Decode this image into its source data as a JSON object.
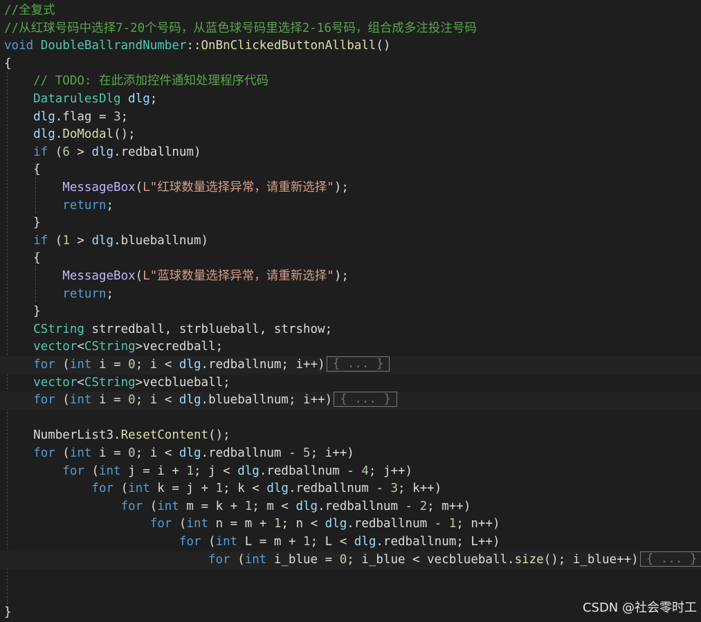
{
  "editor": {
    "lines": [
      [
        {
          "t": "//全复式",
          "c": "comment"
        }
      ],
      [
        {
          "t": "//从红球号码中选择7-20个号码，从蓝色球号码里选择2-16号码，组合成多注投注号码",
          "c": "comment"
        }
      ],
      [
        {
          "t": "void ",
          "c": "kw"
        },
        {
          "t": "DoubleBallrandNumber",
          "c": "type"
        },
        {
          "t": "::",
          "c": "plain"
        },
        {
          "t": "OnBnClickedButtonAllball",
          "c": "fn"
        },
        {
          "t": "()",
          "c": "plain"
        }
      ],
      [
        {
          "t": "{",
          "c": "plain"
        }
      ],
      [
        {
          "t": "    // TODO: 在此添加控件通知处理程序代码",
          "c": "comment"
        }
      ],
      [
        {
          "t": "    DatarulesDlg ",
          "c": "type"
        },
        {
          "t": "dlg",
          "c": "var"
        },
        {
          "t": ";",
          "c": "plain"
        }
      ],
      [
        {
          "t": "    dlg",
          "c": "var"
        },
        {
          "t": ".flag = ",
          "c": "plain"
        },
        {
          "t": "3",
          "c": "num"
        },
        {
          "t": ";",
          "c": "plain"
        }
      ],
      [
        {
          "t": "    dlg",
          "c": "var"
        },
        {
          "t": ".",
          "c": "plain"
        },
        {
          "t": "DoModal",
          "c": "fn"
        },
        {
          "t": "();",
          "c": "plain"
        }
      ],
      [
        {
          "t": "    if ",
          "c": "kw"
        },
        {
          "t": "(",
          "c": "plain"
        },
        {
          "t": "6",
          "c": "num"
        },
        {
          "t": " > ",
          "c": "plain"
        },
        {
          "t": "dlg",
          "c": "var"
        },
        {
          "t": ".redballnum)",
          "c": "plain"
        }
      ],
      [
        {
          "t": "    {",
          "c": "plain"
        }
      ],
      [
        {
          "t": "        MessageBox",
          "c": "macro"
        },
        {
          "t": "(",
          "c": "plain"
        },
        {
          "t": "L\"红球数量选择异常，请重新选择\"",
          "c": "str"
        },
        {
          "t": ");",
          "c": "plain"
        }
      ],
      [
        {
          "t": "        return",
          "c": "kw"
        },
        {
          "t": ";",
          "c": "plain"
        }
      ],
      [
        {
          "t": "    }",
          "c": "plain"
        }
      ],
      [
        {
          "t": "    if ",
          "c": "kw"
        },
        {
          "t": "(",
          "c": "plain"
        },
        {
          "t": "1",
          "c": "num"
        },
        {
          "t": " > ",
          "c": "plain"
        },
        {
          "t": "dlg",
          "c": "var"
        },
        {
          "t": ".blueballnum)",
          "c": "plain"
        }
      ],
      [
        {
          "t": "    {",
          "c": "plain"
        }
      ],
      [
        {
          "t": "        MessageBox",
          "c": "macro"
        },
        {
          "t": "(",
          "c": "plain"
        },
        {
          "t": "L\"蓝球数量选择异常，请重新选择\"",
          "c": "str"
        },
        {
          "t": ");",
          "c": "plain"
        }
      ],
      [
        {
          "t": "        return",
          "c": "kw"
        },
        {
          "t": ";",
          "c": "plain"
        }
      ],
      [
        {
          "t": "    }",
          "c": "plain"
        }
      ],
      [
        {
          "t": "    CString ",
          "c": "type"
        },
        {
          "t": "strredball, strblueball, strshow;",
          "c": "plain"
        }
      ],
      [
        {
          "t": "    vector",
          "c": "type"
        },
        {
          "t": "<",
          "c": "plain"
        },
        {
          "t": "CString",
          "c": "type"
        },
        {
          "t": ">",
          "c": "plain"
        },
        {
          "t": "vecredball;",
          "c": "plain"
        }
      ],
      [
        {
          "t": "    for ",
          "c": "kw"
        },
        {
          "t": "(",
          "c": "plain"
        },
        {
          "t": "int ",
          "c": "kw"
        },
        {
          "t": "i = ",
          "c": "plain"
        },
        {
          "t": "0",
          "c": "num"
        },
        {
          "t": "; i < ",
          "c": "plain"
        },
        {
          "t": "dlg",
          "c": "var"
        },
        {
          "t": ".redballnum; i++)",
          "c": "plain"
        }
      ],
      [
        {
          "t": "    vector",
          "c": "type"
        },
        {
          "t": "<",
          "c": "plain"
        },
        {
          "t": "CString",
          "c": "type"
        },
        {
          "t": ">",
          "c": "plain"
        },
        {
          "t": "vecblueball;",
          "c": "plain"
        }
      ],
      [
        {
          "t": "    for ",
          "c": "kw"
        },
        {
          "t": "(",
          "c": "plain"
        },
        {
          "t": "int ",
          "c": "kw"
        },
        {
          "t": "i = ",
          "c": "plain"
        },
        {
          "t": "0",
          "c": "num"
        },
        {
          "t": "; i < ",
          "c": "plain"
        },
        {
          "t": "dlg",
          "c": "var"
        },
        {
          "t": ".blueballnum; i++)",
          "c": "plain"
        }
      ],
      [],
      [
        {
          "t": "    NumberList3",
          "c": "plain"
        },
        {
          "t": ".",
          "c": "plain"
        },
        {
          "t": "ResetContent",
          "c": "fn"
        },
        {
          "t": "();",
          "c": "plain"
        }
      ],
      [
        {
          "t": "    for ",
          "c": "kw"
        },
        {
          "t": "(",
          "c": "plain"
        },
        {
          "t": "int ",
          "c": "kw"
        },
        {
          "t": "i = ",
          "c": "plain"
        },
        {
          "t": "0",
          "c": "num"
        },
        {
          "t": "; i < ",
          "c": "plain"
        },
        {
          "t": "dlg",
          "c": "var"
        },
        {
          "t": ".redballnum - ",
          "c": "plain"
        },
        {
          "t": "5",
          "c": "num"
        },
        {
          "t": "; i++)",
          "c": "plain"
        }
      ],
      [
        {
          "t": "        for ",
          "c": "kw"
        },
        {
          "t": "(",
          "c": "plain"
        },
        {
          "t": "int ",
          "c": "kw"
        },
        {
          "t": "j = i + ",
          "c": "plain"
        },
        {
          "t": "1",
          "c": "num"
        },
        {
          "t": "; j < ",
          "c": "plain"
        },
        {
          "t": "dlg",
          "c": "var"
        },
        {
          "t": ".redballnum - ",
          "c": "plain"
        },
        {
          "t": "4",
          "c": "num"
        },
        {
          "t": "; j++)",
          "c": "plain"
        }
      ],
      [
        {
          "t": "            for ",
          "c": "kw"
        },
        {
          "t": "(",
          "c": "plain"
        },
        {
          "t": "int ",
          "c": "kw"
        },
        {
          "t": "k = j + ",
          "c": "plain"
        },
        {
          "t": "1",
          "c": "num"
        },
        {
          "t": "; k < ",
          "c": "plain"
        },
        {
          "t": "dlg",
          "c": "var"
        },
        {
          "t": ".redballnum - ",
          "c": "plain"
        },
        {
          "t": "3",
          "c": "num"
        },
        {
          "t": "; k++)",
          "c": "plain"
        }
      ],
      [
        {
          "t": "                for ",
          "c": "kw"
        },
        {
          "t": "(",
          "c": "plain"
        },
        {
          "t": "int ",
          "c": "kw"
        },
        {
          "t": "m = k + ",
          "c": "plain"
        },
        {
          "t": "1",
          "c": "num"
        },
        {
          "t": "; m < ",
          "c": "plain"
        },
        {
          "t": "dlg",
          "c": "var"
        },
        {
          "t": ".redballnum - ",
          "c": "plain"
        },
        {
          "t": "2",
          "c": "num"
        },
        {
          "t": "; m++)",
          "c": "plain"
        }
      ],
      [
        {
          "t": "                    for ",
          "c": "kw"
        },
        {
          "t": "(",
          "c": "plain"
        },
        {
          "t": "int ",
          "c": "kw"
        },
        {
          "t": "n = m + ",
          "c": "plain"
        },
        {
          "t": "1",
          "c": "num"
        },
        {
          "t": "; n < ",
          "c": "plain"
        },
        {
          "t": "dlg",
          "c": "var"
        },
        {
          "t": ".redballnum - ",
          "c": "plain"
        },
        {
          "t": "1",
          "c": "num"
        },
        {
          "t": "; n++)",
          "c": "plain"
        }
      ],
      [
        {
          "t": "                        for ",
          "c": "kw"
        },
        {
          "t": "(",
          "c": "plain"
        },
        {
          "t": "int ",
          "c": "kw"
        },
        {
          "t": "L = m + ",
          "c": "plain"
        },
        {
          "t": "1",
          "c": "num"
        },
        {
          "t": "; L < ",
          "c": "plain"
        },
        {
          "t": "dlg",
          "c": "var"
        },
        {
          "t": ".redballnum; L++)",
          "c": "plain"
        }
      ],
      [
        {
          "t": "                            for ",
          "c": "kw"
        },
        {
          "t": "(",
          "c": "plain"
        },
        {
          "t": "int ",
          "c": "kw"
        },
        {
          "t": "i_blue = ",
          "c": "plain"
        },
        {
          "t": "0",
          "c": "num"
        },
        {
          "t": "; i_blue < vecblueball.",
          "c": "plain"
        },
        {
          "t": "size",
          "c": "fn"
        },
        {
          "t": "(); i_blue++)",
          "c": "plain"
        }
      ],
      [],
      [],
      [
        {
          "t": "}",
          "c": "plain"
        }
      ]
    ],
    "collapsed_label": "{ ... }",
    "collapsed_lines": [
      20,
      22,
      31
    ],
    "highlighted_lines": [
      20,
      22,
      31
    ]
  },
  "watermark": "CSDN @社会零时工",
  "colors": {
    "background": "#1e1e1e",
    "comment": "#57a64a",
    "keyword": "#569cd6",
    "type": "#4ec9b0",
    "function": "#dcdcaa",
    "macro": "#beb7ff",
    "string": "#d69d85",
    "number": "#b5cea8"
  }
}
